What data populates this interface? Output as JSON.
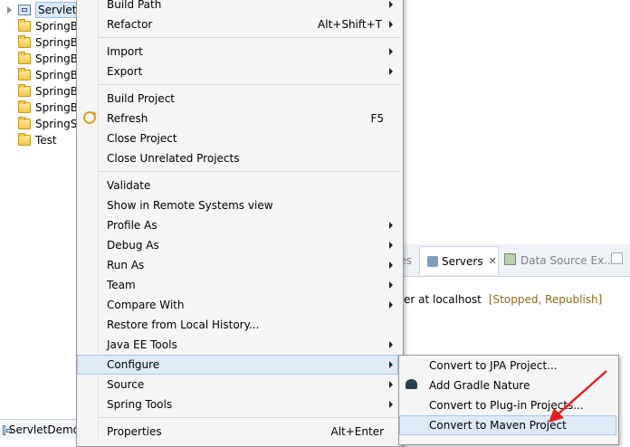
{
  "explorer": {
    "items": [
      {
        "label": "ServletD",
        "type": "project",
        "selected": true,
        "expandable": true
      },
      {
        "label": "SpringB",
        "type": "folder"
      },
      {
        "label": "SpringB",
        "type": "folder"
      },
      {
        "label": "SpringB",
        "type": "folder"
      },
      {
        "label": "SpringB",
        "type": "folder"
      },
      {
        "label": "SpringB",
        "type": "folder"
      },
      {
        "label": "SpringB",
        "type": "folder"
      },
      {
        "label": "SpringSe",
        "type": "folder"
      },
      {
        "label": "Test",
        "type": "folder"
      }
    ]
  },
  "bottom_tab": {
    "label": "ServletDemo"
  },
  "servers_view": {
    "prev_tab_fragment": "ies",
    "tab_label": "Servers",
    "next_tab_label": "Data Source Ex...",
    "server_text": "er at localhost",
    "server_status": "[Stopped, Republish]"
  },
  "context_menu": {
    "items": [
      {
        "label": "Build Path",
        "submenu": true
      },
      {
        "label": "Refactor",
        "accel": "Alt+Shift+T",
        "submenu": true
      },
      {
        "label": "Import",
        "submenu": true
      },
      {
        "label": "Export",
        "submenu": true
      },
      {
        "label": "Build Project"
      },
      {
        "label": "Refresh",
        "accel": "F5",
        "icon": "refresh-icon"
      },
      {
        "label": "Close Project"
      },
      {
        "label": "Close Unrelated Projects"
      },
      {
        "label": "Validate"
      },
      {
        "label": "Show in Remote Systems view"
      },
      {
        "label": "Profile As",
        "submenu": true
      },
      {
        "label": "Debug As",
        "submenu": true
      },
      {
        "label": "Run As",
        "submenu": true
      },
      {
        "label": "Team",
        "submenu": true
      },
      {
        "label": "Compare With",
        "submenu": true
      },
      {
        "label": "Restore from Local History..."
      },
      {
        "label": "Java EE Tools",
        "submenu": true
      },
      {
        "label": "Configure",
        "submenu": true,
        "active": true
      },
      {
        "label": "Source",
        "submenu": true
      },
      {
        "label": "Spring Tools",
        "submenu": true
      },
      {
        "label": "Properties",
        "accel": "Alt+Enter"
      }
    ]
  },
  "configure_submenu": {
    "items": [
      {
        "label": "Convert to JPA Project..."
      },
      {
        "label": "Add Gradle Nature",
        "icon": "gradle-elephant-icon"
      },
      {
        "label": "Convert to Plug-in Projects..."
      },
      {
        "label": "Convert to Maven Project",
        "active": true
      }
    ]
  },
  "colors": {
    "menu_bg": "#f5f5f5",
    "highlight_bg": "#dfeaf8",
    "highlight_border": "#a7c4e8",
    "annotation_arrow": "#e02020",
    "status_text": "#8a6a1d"
  }
}
